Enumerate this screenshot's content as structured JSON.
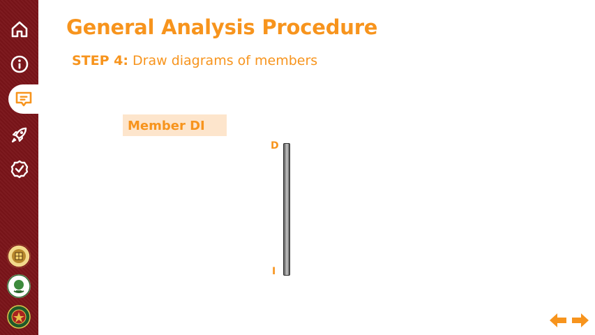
{
  "header": {
    "title": "General Analysis Procedure",
    "step_label": "STEP 4:",
    "step_text": "Draw diagrams of members"
  },
  "member": {
    "label": "Member DI",
    "top_node": "D",
    "bottom_node": "I"
  },
  "sidebar": {
    "items": [
      {
        "icon": "home-icon",
        "active": false
      },
      {
        "icon": "info-icon",
        "active": false
      },
      {
        "icon": "chat-icon",
        "active": true
      },
      {
        "icon": "rocket-icon",
        "active": false
      },
      {
        "icon": "check-circle-icon",
        "active": false
      }
    ],
    "logos": [
      "college-seal-logo",
      "department-seal-logo",
      "university-seal-logo"
    ]
  },
  "navigation": {
    "prev": "left-arrow-icon",
    "next": "right-arrow-icon"
  },
  "colors": {
    "accent": "#f7941d",
    "sidebar": "#7a1419",
    "label_bg": "#fde5cc"
  }
}
